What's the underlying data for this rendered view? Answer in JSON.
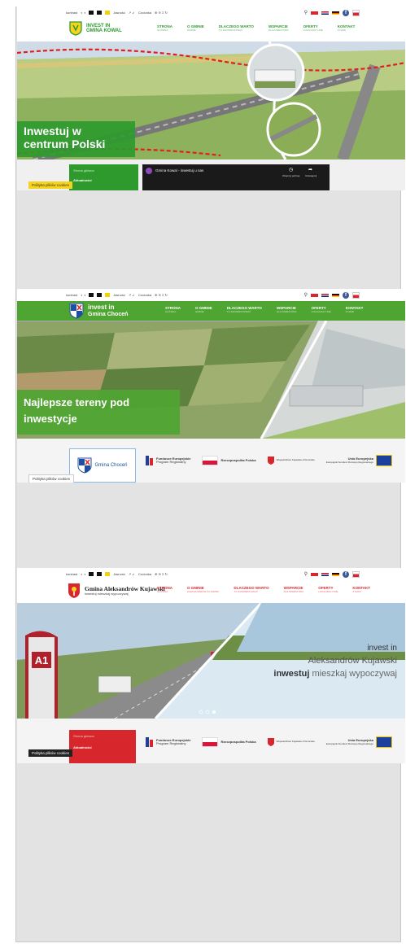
{
  "common": {
    "kontrast": "kontrast",
    "jasnosc": "Jasność",
    "czcionka": "Czcionka",
    "cookie": "Polityka plików cookies"
  },
  "site1": {
    "logo_line1": "INVEST IN",
    "logo_line2": "GMINA KOWAL",
    "menu": [
      {
        "label": "STRONA",
        "sub": "GŁÓWNA"
      },
      {
        "label": "O GMINIE",
        "sub": "GMINIE"
      },
      {
        "label": "DLACZEGO WARTO",
        "sub": "TU ZAINWESTOWAĆ"
      },
      {
        "label": "WSPARCIE",
        "sub": "DLA INWESTORA"
      },
      {
        "label": "OFERTY",
        "sub": "LOKALIZACYJNE"
      },
      {
        "label": "KONTAKT",
        "sub": "Z NAMI"
      }
    ],
    "hero_line1": "Inwestuj w",
    "hero_line2": "centrum Polski",
    "sidebar_item1": "Strona główna",
    "sidebar_item2": "Aktualności",
    "video_title": "Gmina Kowal - inwestuj u nas",
    "video_watch_later": "Obejrzyj później",
    "video_share": "Udostępnij"
  },
  "site2": {
    "logo_line1": "invest in",
    "logo_line2": "Gmina Choceń",
    "menu": [
      {
        "label": "STRONA",
        "sub": "GŁÓWNA"
      },
      {
        "label": "O GMINIE",
        "sub": "GMINIE"
      },
      {
        "label": "DLACZEGO WARTO",
        "sub": "TU ZAINWESTOWAĆ"
      },
      {
        "label": "WSPARCIE",
        "sub": "DLA INWESTORA"
      },
      {
        "label": "OFERTY",
        "sub": "LOKALIZACYJNE"
      },
      {
        "label": "KONTAKT",
        "sub": "Z NAMI"
      }
    ],
    "hero_line1": "Najlepsze tereny pod",
    "hero_line2": "inwestycje",
    "side_logo": "Gmina Choceń",
    "partners": [
      "Fundusze Europejskie",
      "Program Regionalny",
      "Rzeczpospolita Polska",
      "Województwo Kujawsko-Pomorskie",
      "Unia Europejska",
      "Europejski Fundusz Rozwoju Regionalnego"
    ]
  },
  "site3": {
    "logo_line1": "Gmina Aleksandrów Kujawski",
    "logo_line2": "inwestuj mieszkaj wypoczywaj",
    "menu": [
      {
        "label": "STRONA",
        "sub": "GŁÓWNA"
      },
      {
        "label": "O GMINIE",
        "sub": "ALEKSANDRÓW KUJAWSKI"
      },
      {
        "label": "DLACZEGO WARTO",
        "sub": "TU ZAINWESTOWAĆ"
      },
      {
        "label": "WSPARCIE",
        "sub": "DLA INWESTORA"
      },
      {
        "label": "OFERTY",
        "sub": "LOKALIZACYJNE"
      },
      {
        "label": "KONTAKT",
        "sub": "Z NAMI"
      }
    ],
    "road_sign": "A1",
    "hero_line1": "invest in",
    "hero_line2": "Aleksandrów Kujawski",
    "hero_line3a": "inwestuj",
    "hero_line3b": "mieszkaj wypoczywaj",
    "sidebar_item1": "Strona główna",
    "sidebar_item2": "Aktualności",
    "partners": [
      "Fundusze Europejskie",
      "Program Regionalny",
      "Rzeczpospolita Polska",
      "Województwo Kujawsko-Pomorskie",
      "Unia Europejska",
      "Europejski Fundusz Rozwoju Regionalnego"
    ]
  },
  "colors": {
    "kowal_green": "#2e9a2e",
    "chocen_green": "#4fa531",
    "aleks_red": "#d8262d",
    "frame_gray": "#e3e3e3"
  }
}
